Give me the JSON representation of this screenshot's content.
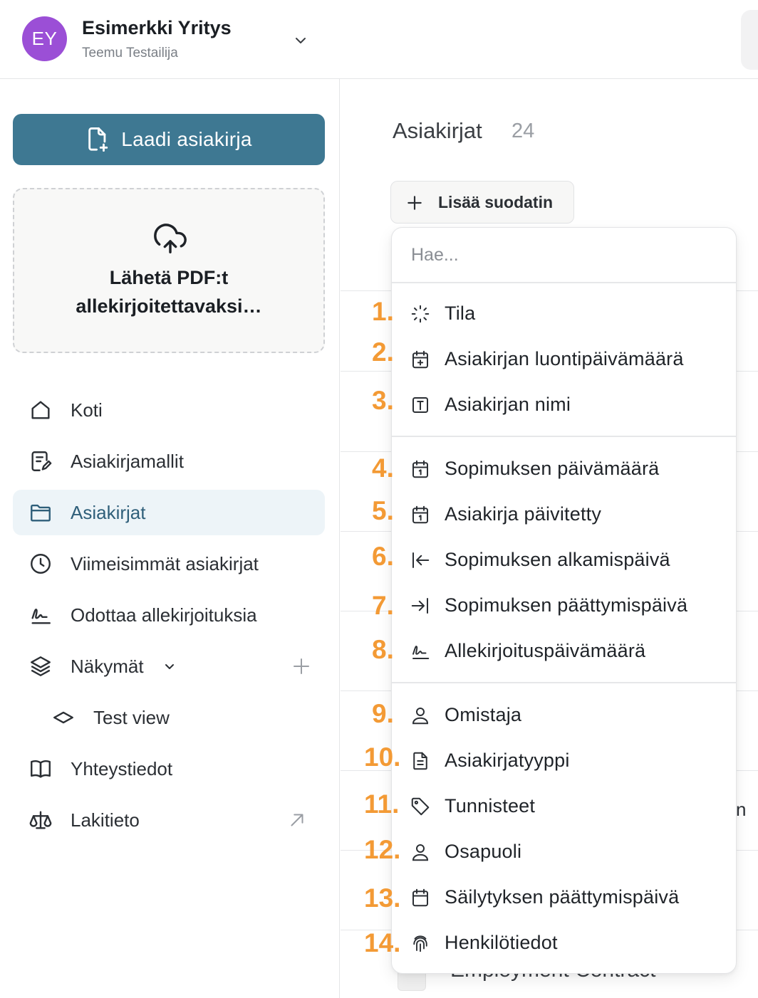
{
  "header": {
    "avatar_initials": "EY",
    "org_name": "Esimerkki Yritys",
    "user_name": "Teemu Testailija"
  },
  "sidebar": {
    "compose_label": "Laadi asiakirja",
    "upload_line1": "Lähetä PDF:t",
    "upload_line2": "allekirjoitettavaksi…",
    "items": [
      {
        "label": "Koti",
        "icon": "home-icon"
      },
      {
        "label": "Asiakirjamallit",
        "icon": "template-icon"
      },
      {
        "label": "Asiakirjat",
        "icon": "folder-icon",
        "active": true
      },
      {
        "label": "Viimeisimmät asiakirjat",
        "icon": "clock-icon"
      },
      {
        "label": "Odottaa allekirjoituksia",
        "icon": "signature-icon"
      },
      {
        "label": "Näkymät",
        "icon": "layers-icon"
      },
      {
        "label": "Test view",
        "icon": "view-icon"
      },
      {
        "label": "Yhteystiedot",
        "icon": "book-icon"
      },
      {
        "label": "Lakitieto",
        "icon": "scales-icon"
      }
    ]
  },
  "main": {
    "title": "Asiakirjat",
    "count": "24",
    "filter_label": "Lisää suodatin",
    "bg_fragment": "n",
    "bg_bottom": "Employment Contract"
  },
  "dropdown": {
    "search_placeholder": "Hae...",
    "items": [
      {
        "label": "Tila",
        "icon": "loader-icon"
      },
      {
        "label": "Asiakirjan luontipäivämäärä",
        "icon": "calendar-plus-icon"
      },
      {
        "label": "Asiakirjan nimi",
        "icon": "text-box-icon"
      },
      {
        "label": "Sopimuksen päivämäärä",
        "icon": "calendar-one-icon"
      },
      {
        "label": "Asiakirja päivitetty",
        "icon": "calendar-one-icon"
      },
      {
        "label": "Sopimuksen alkamispäivä",
        "icon": "arrow-to-left-icon"
      },
      {
        "label": "Sopimuksen päättymispäivä",
        "icon": "arrow-to-right-icon"
      },
      {
        "label": "Allekirjoituspäivämäärä",
        "icon": "signature-icon"
      },
      {
        "label": "Omistaja",
        "icon": "user-icon"
      },
      {
        "label": "Asiakirjatyyppi",
        "icon": "file-text-icon"
      },
      {
        "label": "Tunnisteet",
        "icon": "tag-icon"
      },
      {
        "label": "Osapuoli",
        "icon": "user-icon"
      },
      {
        "label": "Säilytyksen päättymispäivä",
        "icon": "calendar-icon"
      },
      {
        "label": "Henkilötiedot",
        "icon": "fingerprint-icon"
      }
    ]
  },
  "markers": [
    "1.",
    "2.",
    "3.",
    "4.",
    "5.",
    "6.",
    "7.",
    "8.",
    "9.",
    "10.",
    "11.",
    "12.",
    "13.",
    "14."
  ],
  "colors": {
    "accent": "#3e7892",
    "avatar": "#9b4fd6",
    "marker": "#f39a35",
    "active_bg": "#edf4f8"
  }
}
